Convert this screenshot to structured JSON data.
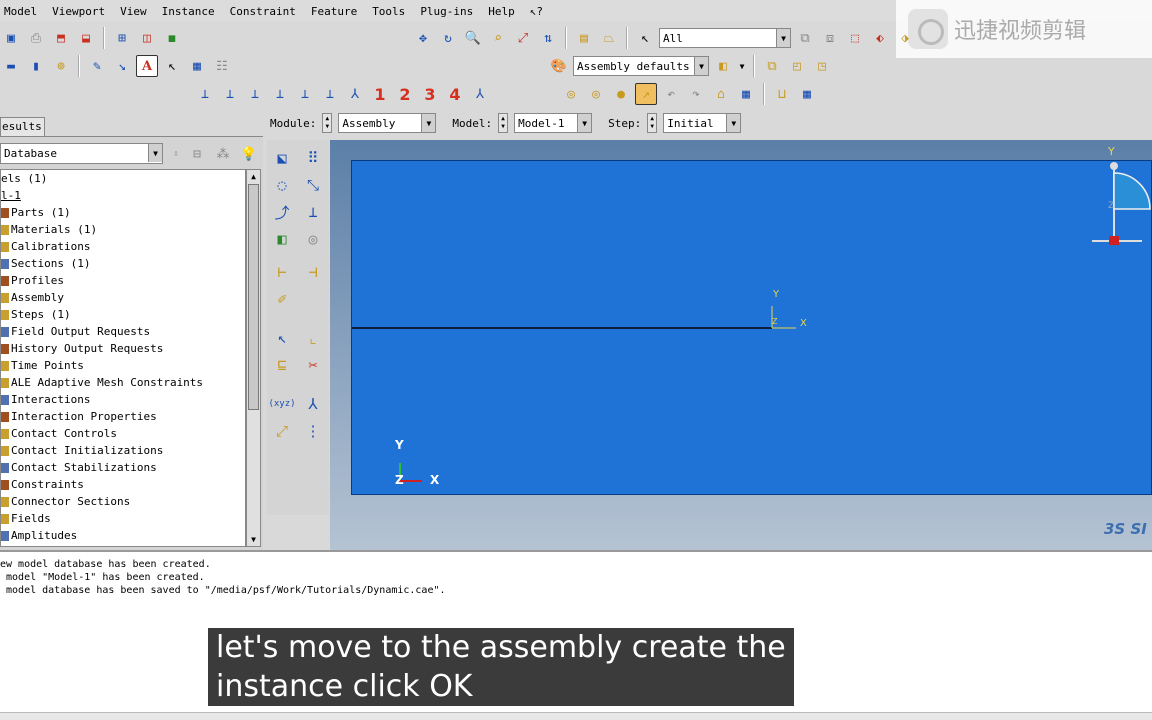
{
  "menu": [
    "Model",
    "Viewport",
    "View",
    "Instance",
    "Constraint",
    "Feature",
    "Tools",
    "Plug-ins",
    "Help",
    "↖?"
  ],
  "watermark": {
    "text": "迅捷视频剪辑"
  },
  "toolbar": {
    "select_filter": "All",
    "display_group": "Assembly defaults",
    "view_numbers": [
      "1",
      "2",
      "3",
      "4"
    ]
  },
  "context": {
    "module_label": "Module:",
    "module_value": "Assembly",
    "model_label": "Model:",
    "model_value": "Model-1",
    "step_label": "Step:",
    "step_value": "Initial"
  },
  "left_panel": {
    "tab_label": "esults",
    "db_combo": "Database",
    "tree": [
      {
        "text": "els (1)",
        "indent": 0,
        "icon": false
      },
      {
        "text": "l-1",
        "indent": 0,
        "icon": false,
        "underline": true
      },
      {
        "text": "Parts (1)",
        "indent": 1,
        "icon": true
      },
      {
        "text": "Materials (1)",
        "indent": 1,
        "icon": true
      },
      {
        "text": "Calibrations",
        "indent": 1,
        "icon": true
      },
      {
        "text": "Sections (1)",
        "indent": 1,
        "icon": true
      },
      {
        "text": "Profiles",
        "indent": 1,
        "icon": true
      },
      {
        "text": "Assembly",
        "indent": 1,
        "icon": true
      },
      {
        "text": "Steps (1)",
        "indent": 1,
        "icon": true
      },
      {
        "text": "Field Output Requests",
        "indent": 1,
        "icon": true
      },
      {
        "text": "History Output Requests",
        "indent": 1,
        "icon": true
      },
      {
        "text": "Time Points",
        "indent": 1,
        "icon": true
      },
      {
        "text": "ALE Adaptive Mesh Constraints",
        "indent": 1,
        "icon": true
      },
      {
        "text": "Interactions",
        "indent": 1,
        "icon": true
      },
      {
        "text": "Interaction Properties",
        "indent": 1,
        "icon": true
      },
      {
        "text": "Contact Controls",
        "indent": 1,
        "icon": true
      },
      {
        "text": "Contact Initializations",
        "indent": 1,
        "icon": true
      },
      {
        "text": "Contact Stabilizations",
        "indent": 1,
        "icon": true
      },
      {
        "text": "Constraints",
        "indent": 1,
        "icon": true
      },
      {
        "text": "Connector Sections",
        "indent": 1,
        "icon": true
      },
      {
        "text": "Fields",
        "indent": 1,
        "icon": true
      },
      {
        "text": "Amplitudes",
        "indent": 1,
        "icon": true
      }
    ]
  },
  "viewport": {
    "triad_small": {
      "x": "X",
      "y": "Y",
      "z": "Z"
    },
    "triad_corner": {
      "x": "X",
      "y": "Y",
      "z": "Z"
    },
    "triad_top": {
      "y": "Y",
      "z": "Z"
    },
    "brand": "3S SI"
  },
  "messages": [
    "ew model database has been created.",
    " model \"Model-1\" has been created.",
    " model database has been saved to \"/media/psf/Work/Tutorials/Dynamic.cae\"."
  ],
  "subtitle": [
    "let's move to the assembly create the",
    "instance click OK"
  ],
  "colors": {
    "viewport": "#1f73d6",
    "axis_yellow": "#e8d44a",
    "origin_red": "#d02020"
  }
}
